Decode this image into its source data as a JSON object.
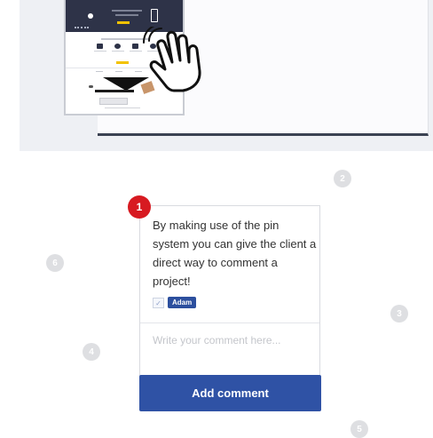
{
  "pins": [
    {
      "number": "1"
    },
    {
      "number": "2"
    },
    {
      "number": "3"
    },
    {
      "number": "4"
    },
    {
      "number": "5"
    },
    {
      "number": "6"
    }
  ],
  "comment": {
    "text": "By making use of the pin system you can give the client a direct way to comment a project!",
    "author_tag": "Adam",
    "check_icon": "check-icon"
  },
  "reply": {
    "placeholder": "Write your comment here...",
    "submit_label": "Add comment"
  },
  "colors": {
    "accent": "#2f52a5",
    "active_pin": "#d71a21",
    "inactive_pin": "#dedfe2",
    "preview_dark": "#2e3348",
    "preview_yellow": "#f2c200"
  }
}
